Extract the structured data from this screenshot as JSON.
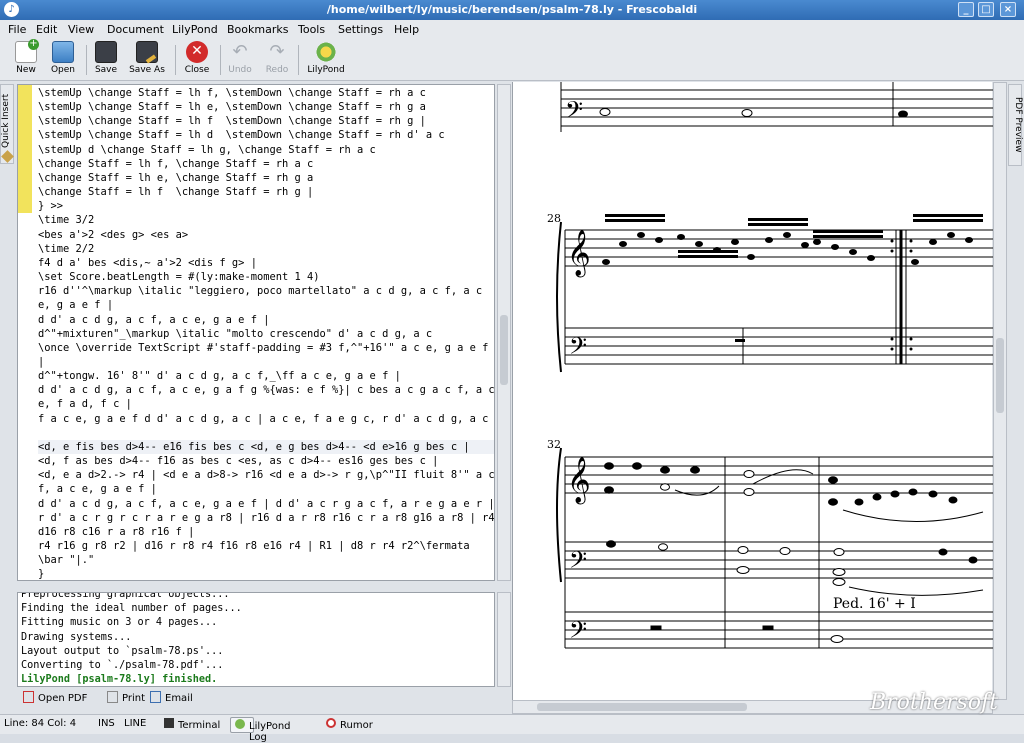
{
  "window": {
    "title": "/home/wilbert/ly/music/berendsen/psalm-78.ly - Frescobaldi"
  },
  "menu": [
    "File",
    "Edit",
    "View",
    "Document",
    "LilyPond",
    "Bookmarks",
    "Tools",
    "Settings",
    "Help"
  ],
  "toolbar": {
    "new": "New",
    "open": "Open",
    "save": "Save",
    "save_as": "Save As",
    "close": "Close",
    "undo": "Undo",
    "redo": "Redo",
    "lilypond": "LilyPond"
  },
  "sidetab": {
    "quick_insert": "Quick Insert",
    "pdf_preview": "PDF Preview"
  },
  "editor": {
    "lines": [
      "\\stemUp \\change Staff = lh f, \\stemDown \\change Staff = rh a c",
      "\\stemUp \\change Staff = lh e, \\stemDown \\change Staff = rh g a",
      "\\stemUp \\change Staff = lh f  \\stemDown \\change Staff = rh g |",
      "\\stemUp \\change Staff = lh d  \\stemDown \\change Staff = rh d' a c",
      "\\stemUp d \\change Staff = lh g, \\change Staff = rh a c",
      "\\change Staff = lh f, \\change Staff = rh a c",
      "\\change Staff = lh e, \\change Staff = rh g a",
      "\\change Staff = lh f  \\change Staff = rh g |",
      "} >>",
      "\\time 3/2",
      "<bes a'>2 <des g> <es a>",
      "\\time 2/2",
      "f4 d a' bes <dis,~ a'>2 <dis f g> |",
      "\\set Score.beatLength = #(ly:make-moment 1 4)",
      "r16 d''^\\markup \\italic \"leggiero, poco martellato\" a c d g, a c f, a c",
      "e, g a e f |",
      "d d' a c d g, a c f, a c e, g a e f |",
      "d^\"+mixturen\"_\\markup \\italic \"molto crescendo\" d' a c d g, a c",
      "\\once \\override TextScript #'staff-padding = #3 f,^\"+16'\" a c e, g a e f",
      "|",
      "d^\"+tongw. 16' 8'\" d' a c d g, a c f,_\\ff a c e, g a e f |",
      "d d' a c d g, a c f, a c e, g a f g %{was: e f %}| c bes a c g a c f, a c",
      "e, f a d, f c |",
      "f a c e, g a e f d d' a c d g, a c | a c e, f a e g c, r d' a c d g, a c |",
      "",
      "<d, e fis bes d>4-- e16 fis bes c <d, e g bes d>4-- <d e>16 g bes c |",
      "<d, f as bes d>4-- f16 as bes c <es, as c d>4-- es16 ges bes c |",
      "<d, e a d>2.-> r4 | <d e a d>8-> r16 <d e a d>-> r g,\\p^\"II fluit 8'\" a c",
      "f, a c e, g a e f |",
      "d d' a c d g, a c f, a c e, g a e f | d d' a c r g a c f, a r e g a e r |",
      "r d' a c r g r c r a r e g a r8 | r16 d a r r8 r16 c r a r8 g16 a r8 | r4",
      "d16 r8 c16 r a r8 r16 f |",
      "r4 r16 g r8 r2 | d16 r r8 r4 f16 r8 e16 r4 | R1 | d8 r r4 r2^\\fermata",
      "\\bar \"|.\"",
      "}"
    ]
  },
  "log": {
    "lines": [
      "Preprocessing graphical objects...",
      "Finding the ideal number of pages...",
      "Fitting music on 3 or 4 pages...",
      "Drawing systems...",
      "Layout output to `psalm-78.ps'...",
      "Converting to `./psalm-78.pdf'..."
    ],
    "finished": "LilyPond [psalm-78.ly] finished."
  },
  "logbar": {
    "open_pdf": "Open PDF",
    "print": "Print",
    "email": "Email"
  },
  "score": {
    "measure_a": "28",
    "measure_b": "32",
    "registration": "Ped. 16' + I"
  },
  "statusbar": {
    "position": "Line: 84 Col: 4",
    "ins": "INS",
    "line_mode": "LINE",
    "terminal": "Terminal",
    "lilypond_log": "LilyPond Log",
    "rumor": "Rumor"
  },
  "watermark": "Brothersoft"
}
